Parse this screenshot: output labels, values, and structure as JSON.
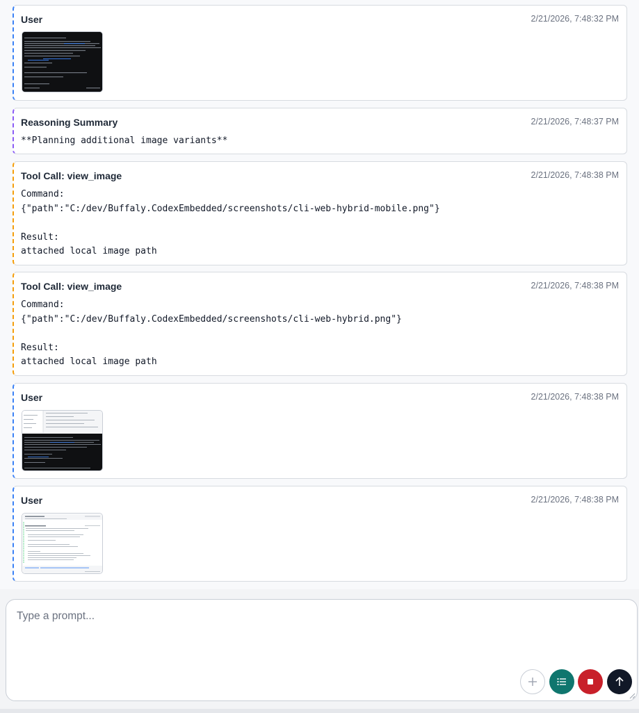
{
  "messages": [
    {
      "title": "User",
      "time": "2/21/2026, 7:48:32 PM"
    },
    {
      "title": "Reasoning Summary",
      "time": "2/21/2026, 7:48:37 PM",
      "text": "**Planning additional image variants**"
    },
    {
      "title": "Tool Call: view_image",
      "time": "2/21/2026, 7:48:38 PM",
      "command_label": "Command:",
      "command": "{\"path\":\"C:/dev/Buffaly.CodexEmbedded/screenshots/cli-web-hybrid-mobile.png\"}",
      "result_label": "Result:",
      "result": "attached local image path"
    },
    {
      "title": "Tool Call: view_image",
      "time": "2/21/2026, 7:48:38 PM",
      "command_label": "Command:",
      "command": "{\"path\":\"C:/dev/Buffaly.CodexEmbedded/screenshots/cli-web-hybrid.png\"}",
      "result_label": "Result:",
      "result": "attached local image path"
    },
    {
      "title": "User",
      "time": "2/21/2026, 7:48:38 PM"
    },
    {
      "title": "User",
      "time": "2/21/2026, 7:48:38 PM"
    }
  ],
  "composer": {
    "placeholder": "Type a prompt...",
    "buttons": {
      "attach": "plus-icon",
      "queue": "list-icon",
      "stop": "stop-icon",
      "send": "arrow-up-icon"
    }
  },
  "colors": {
    "user_accent": "#3b82f6",
    "reasoning_accent": "#8b5cf6",
    "tool_accent": "#f59e0b",
    "queue_button": "#0f766e",
    "stop_button": "#c8202a",
    "send_button": "#111827"
  }
}
